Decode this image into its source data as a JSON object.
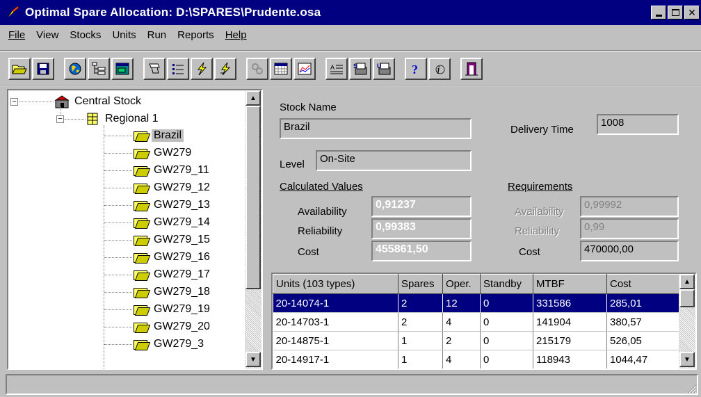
{
  "window": {
    "title": "Optimal Spare Allocation: D:\\SPARES\\Prudente.osa"
  },
  "menu": [
    "File",
    "View",
    "Stocks",
    "Units",
    "Run",
    "Reports",
    "Help"
  ],
  "toolbar": {
    "buttons": [
      "open-icon",
      "save-icon",
      "globe-icon",
      "tree-icon",
      "window-icon",
      "stamp-icon",
      "list-icon",
      "lightning-icon",
      "lightning-alt-icon",
      "link-icon",
      "calendar-icon",
      "chart-icon",
      "text-icon",
      "stock-report-icon",
      "unit-report-icon",
      "help-icon",
      "info-icon",
      "exit-icon"
    ]
  },
  "tree": {
    "root": "Central Stock",
    "regional": "Regional 1",
    "items": [
      "Brazil",
      "GW279",
      "GW279_11",
      "GW279_12",
      "GW279_13",
      "GW279_14",
      "GW279_15",
      "GW279_16",
      "GW279_17",
      "GW279_18",
      "GW279_19",
      "GW279_20",
      "GW279_3"
    ],
    "selected": "Brazil"
  },
  "details": {
    "stock_name_label": "Stock Name",
    "stock_name": "Brazil",
    "delivery_time_label": "Delivery Time",
    "delivery_time": "1008",
    "level_label": "Level",
    "level": "On-Site",
    "calculated_label": "Calculated Values",
    "requirements_label": "Requirements",
    "availability_label": "Availability",
    "reliability_label": "Reliability",
    "cost_label": "Cost",
    "calc_availability": "0,91237",
    "calc_reliability": "0,99383",
    "calc_cost": "455861,50",
    "req_availability": "0,99992",
    "req_reliability": "0,99",
    "req_cost": "470000,00"
  },
  "grid": {
    "headers": [
      "Units (103 types)",
      "Spares",
      "Oper.",
      "Standby",
      "MTBF",
      "Cost"
    ],
    "rows": [
      [
        "20-14074-1",
        "2",
        "12",
        "0",
        "331586",
        "285,01"
      ],
      [
        "20-14703-1",
        "2",
        "4",
        "0",
        "141904",
        "380,57"
      ],
      [
        "20-14875-1",
        "1",
        "2",
        "0",
        "215179",
        "526,05"
      ],
      [
        "20-14917-1",
        "1",
        "4",
        "0",
        "118943",
        "1044,47"
      ]
    ]
  },
  "colors": {
    "titlebar": "#000080",
    "selection": "#000080",
    "face": "#c0c0c0"
  }
}
